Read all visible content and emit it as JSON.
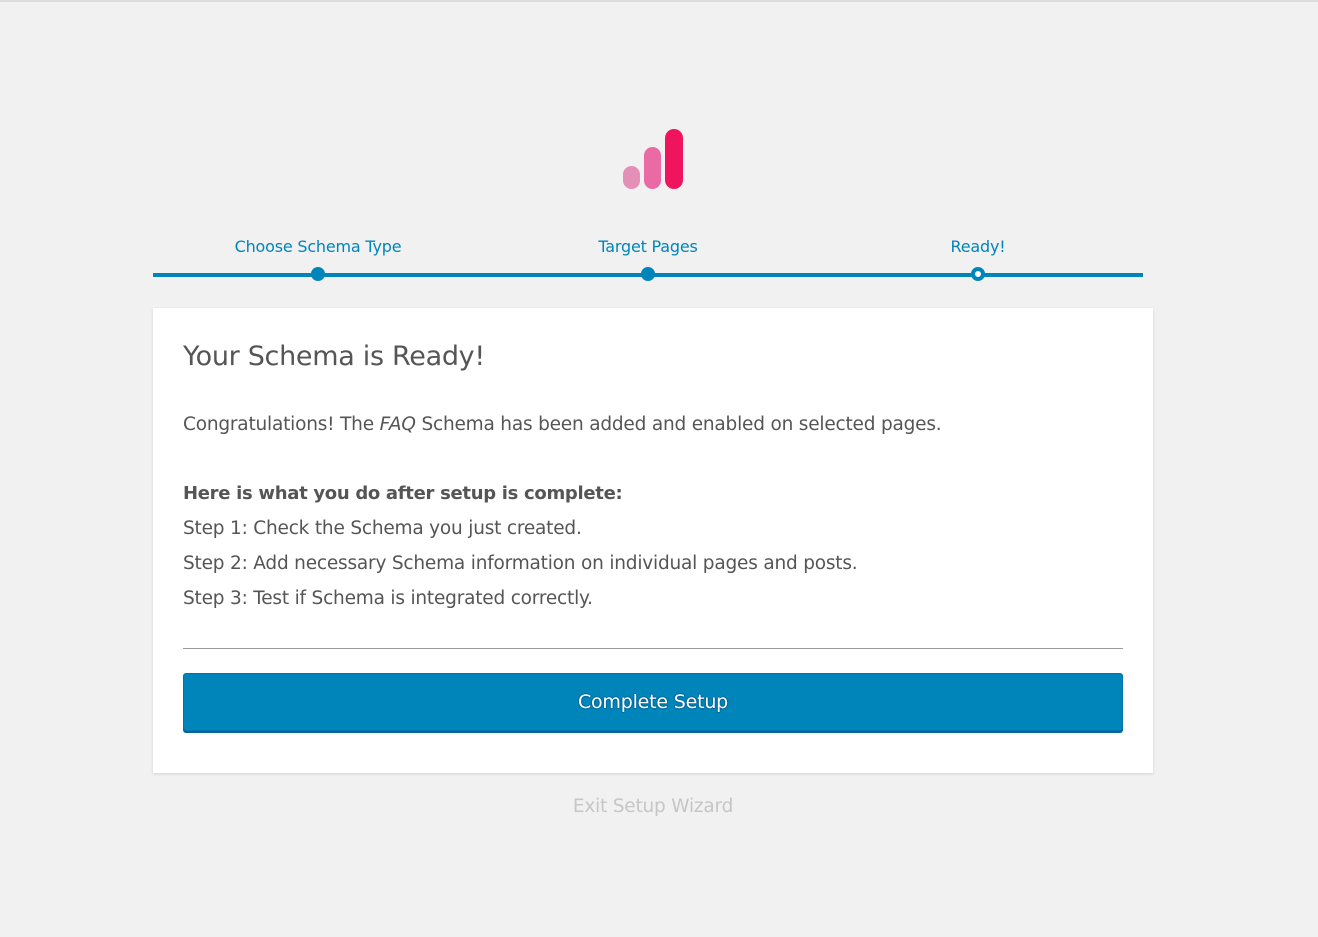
{
  "logo": {
    "icon": "bar-chart-logo-icon",
    "colors": [
      "#e38fb8",
      "#ea6aa5",
      "#f0145f"
    ]
  },
  "progress": {
    "accent": "#0085ba",
    "steps": [
      {
        "label": "Choose Schema Type",
        "state": "done"
      },
      {
        "label": "Target Pages",
        "state": "done"
      },
      {
        "label": "Ready!",
        "state": "current"
      }
    ]
  },
  "card": {
    "title": "Your Schema is Ready!",
    "intro_prefix": "Congratulations! The ",
    "intro_schema": "FAQ",
    "intro_suffix": " Schema has been added and enabled on selected pages.",
    "after_title": "Here is what you do after setup is complete:",
    "steps": [
      "Step 1: Check the Schema you just created.",
      "Step 2: Add necessary Schema information on individual pages and posts.",
      "Step 3: Test if Schema is integrated correctly."
    ],
    "button_label": "Complete Setup"
  },
  "exit_link": "Exit Setup Wizard"
}
